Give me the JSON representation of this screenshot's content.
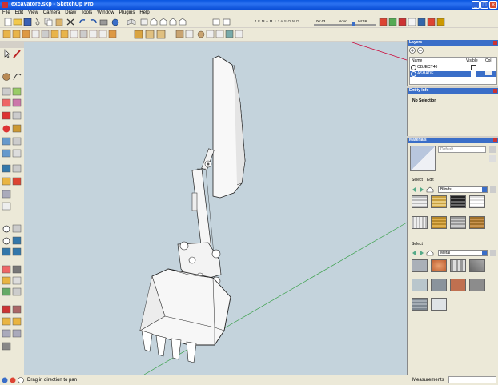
{
  "window": {
    "title": "excavatore.skp - SketchUp Pro"
  },
  "menu": [
    "File",
    "Edit",
    "View",
    "Camera",
    "Draw",
    "Tools",
    "Window",
    "Plugins",
    "Help"
  ],
  "shadow": {
    "months": "J F M A M J J A S O N D",
    "time_a": "06:43",
    "noon": "Noon",
    "time_b": "04:46"
  },
  "layers": {
    "title": "Layers",
    "cols": {
      "name": "Name",
      "visible": "Visible",
      "color": "Col"
    },
    "rows": [
      {
        "name": "OBJECT40",
        "visible": true
      },
      {
        "name": "ASHADE",
        "visible": true
      }
    ]
  },
  "entity": {
    "title": "Entity Info",
    "selection": "No Selection"
  },
  "materials": {
    "title": "Materials",
    "current": "Default",
    "tabs": [
      "Select",
      "Edit"
    ],
    "library_a": "Blinds",
    "select_label": "Select",
    "library_b": "Metal"
  },
  "status": {
    "hint": "Drag in direction to pan",
    "measurements_label": "Measurements"
  }
}
